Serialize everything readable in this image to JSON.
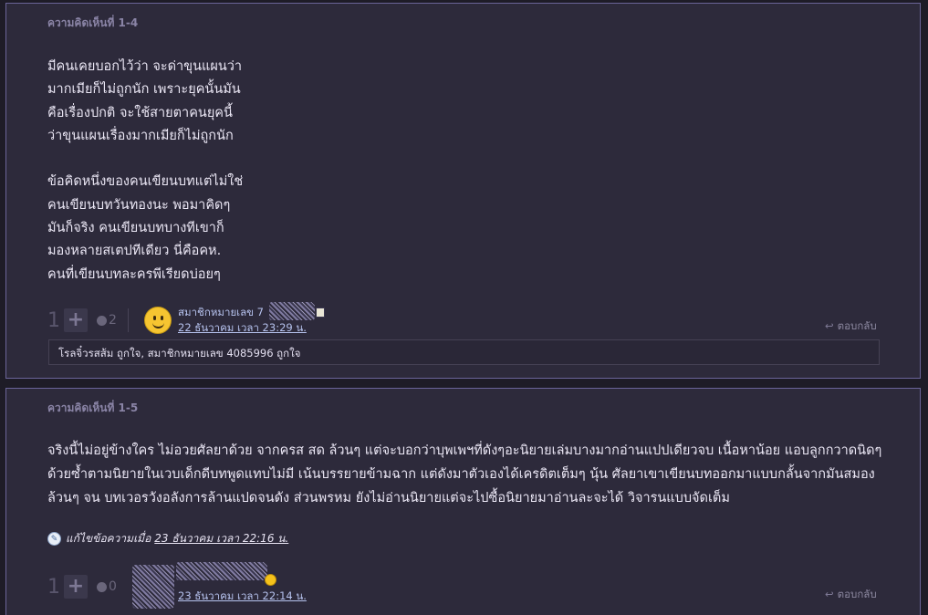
{
  "comments": [
    {
      "title": "ความคิดเห็นที่ 1-4",
      "body": "มีคนเคยบอกไว้ว่า จะด่าขุนแผนว่า\nมากเมียก็ไม่ถูกนัก เพราะยุคนั้นมัน\nคือเรื่องปกติ จะใช้สายตาคนยุคนี้\nว่าขุนแผนเรื่องมากเมียก็ไม่ถูกนัก\n\nข้อคิดหนึ่งของคนเขียนบทแต่ไม่ใช่\nคนเขียนบทวันทองนะ พอมาคิดๆ\nมันก็จริง คนเขียนบทบางทีเขาก็\nมองหลายสเตปทีเดียว นี่คือคห.\nคนที่เขียนบทละครพีเรียดบ่อยๆ",
      "vote_count": "1",
      "emotion_count": "2",
      "author": "สมาชิกหมายเลข 7",
      "date": "22 ธันวาคม เวลา 23:29 น.",
      "reply": "ตอบกลับ",
      "likes": "โรลจิ๋วรสส้ม ถูกใจ, สมาชิกหมายเลข 4085996 ถูกใจ"
    },
    {
      "title": "ความคิดเห็นที่ 1-5",
      "body": "จริงนี้ไม่อยู่ข้างใคร ไม่อวยศัลยาด้วย จากครส สด ล้วนๆ แต่จะบอกว่าบุพเพฯที่ดังๆอะนิยายเล่มบางมากอ่านแปปเดียวจบ เนื้อหาน้อย แอบลูกกวาดนิดๆ ด้วยซ้ำตามนิยายในเวบเด็กดีบทพูดแทบไม่มี เน้นบรรยายข้ามฉาก แต่ดังมาตัวเองได้เครดิตเต็มๆ นุ้น ศัลยาเขาเขียนบทออกมาแบบกลั้นจากมันสมองล้วนๆ จน บทเวอรวังอลังการล้านแปดจนดัง ส่วนพรหม ยังไม่อ่านนิยายแต่จะไปซื้อนิยายมาอ่านละจะได้ วิจารนแบบจัดเต็ม",
      "edit_label": "แก้ไขข้อความเมื่อ",
      "edit_date": "23 ธันวาคม เวลา 22:16 น.",
      "vote_count": "1",
      "emotion_count": "0",
      "date": "23 ธันวาคม เวลา 22:14 น.",
      "reply": "ตอบกลับ"
    }
  ],
  "icons": {
    "plus": "plus-icon",
    "emotion": "emotion-icon",
    "reply": "reply-arrow-icon",
    "avatar": "smiley-avatar",
    "edit": "edit-info-icon"
  }
}
